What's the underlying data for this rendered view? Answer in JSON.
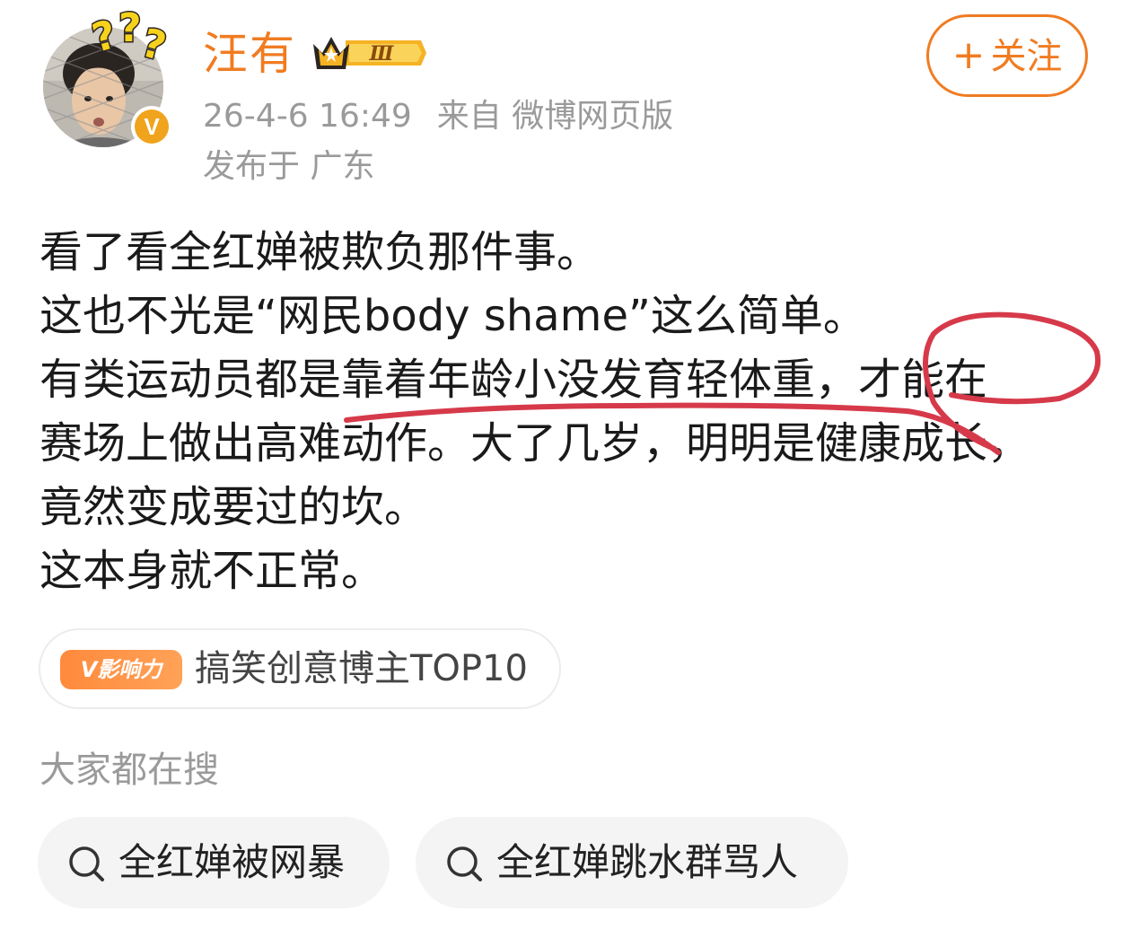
{
  "author": {
    "name": "汪有",
    "rank_badge": "Ⅲ",
    "verified_mark": "V"
  },
  "follow_button": {
    "plus": "+",
    "label": "关注"
  },
  "post_meta": {
    "date_time": "26-4-6 16:49",
    "source": "来自 微博网页版",
    "location": "发布于 广东"
  },
  "post": {
    "lines": [
      "看了看全红婵被欺负那件事。",
      "这也不光是“网民body shame”这么简单。",
      "有类运动员都是靠着年龄小没发育轻体重，才能在",
      "赛场上做出高难动作。大了几岁，明明是健康成长，",
      "竟然变成要过的坎。",
      "这本身就不正常。"
    ]
  },
  "influence": {
    "badge_label": "V影响力",
    "text": "搞笑创意博主TOP10"
  },
  "search_section": {
    "title": "大家都在搜",
    "items": [
      "全红婵被网暴",
      "全红婵跳水群骂人"
    ]
  },
  "colors": {
    "accent_orange": "#f07c22",
    "annotation_red": "#d63a4a",
    "meta_gray": "#9a9a9a"
  }
}
